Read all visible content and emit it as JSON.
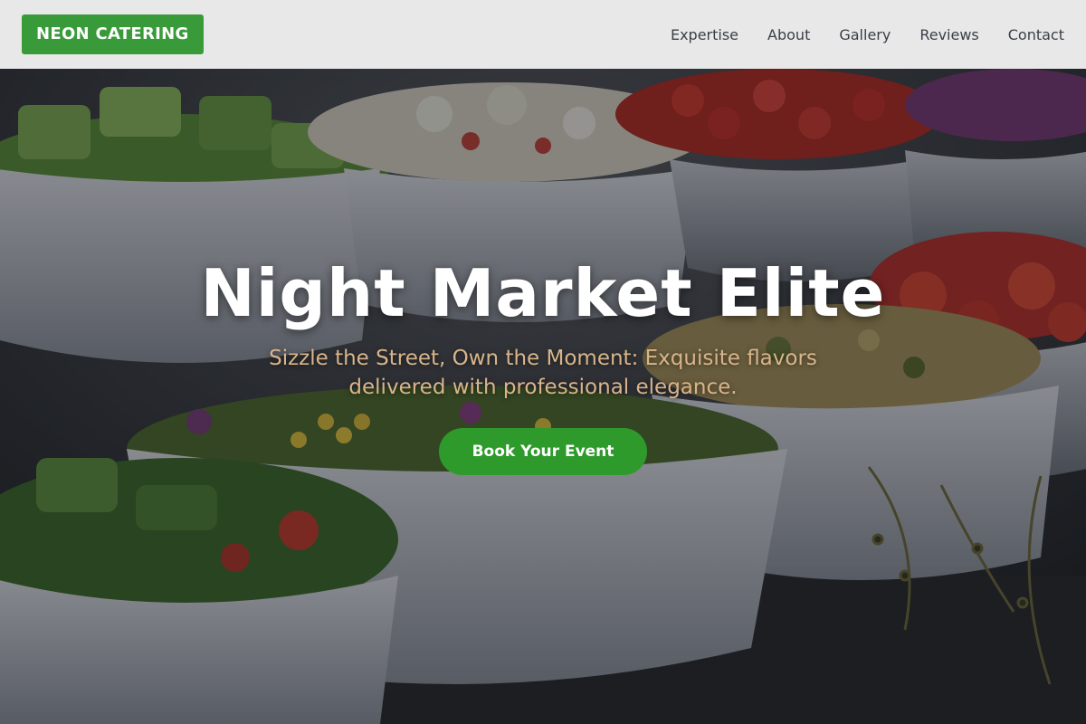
{
  "brand": {
    "logo_text": "NEON CATERING",
    "accent_color": "#399a3a"
  },
  "nav": {
    "items": [
      {
        "label": "Expertise"
      },
      {
        "label": "About"
      },
      {
        "label": "Gallery"
      },
      {
        "label": "Reviews"
      },
      {
        "label": "Contact"
      }
    ]
  },
  "hero": {
    "title": "Night Market Elite",
    "subtitle": "Sizzle the Street, Own the Moment: Exquisite flavors delivered with professional elegance.",
    "cta_label": "Book Your Event",
    "cta_color": "#2f9a2c",
    "background_image": "bowls-of-salads-icon"
  }
}
